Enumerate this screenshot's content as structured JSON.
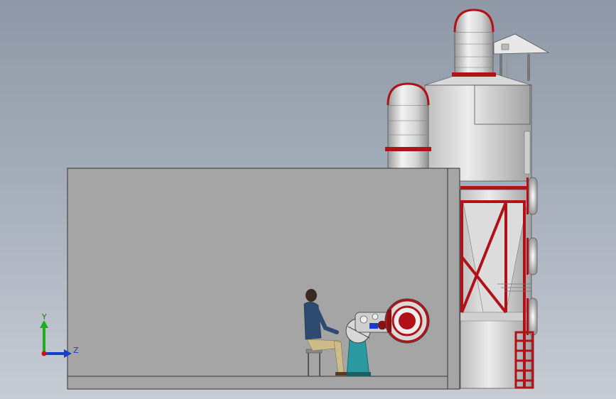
{
  "view": {
    "type": "3d-cad-viewport",
    "background_colors": [
      "#8e98a6",
      "#c7ccd4"
    ],
    "accent_red": "#b01218",
    "metal_light": "#e6e6e6",
    "metal_dark": "#a9a9a9"
  },
  "triad": {
    "y_label": "Y",
    "z_label": "Z",
    "y_color": "#22aa22",
    "z_color": "#1a3ccc",
    "origin_color": "#cc1111"
  }
}
